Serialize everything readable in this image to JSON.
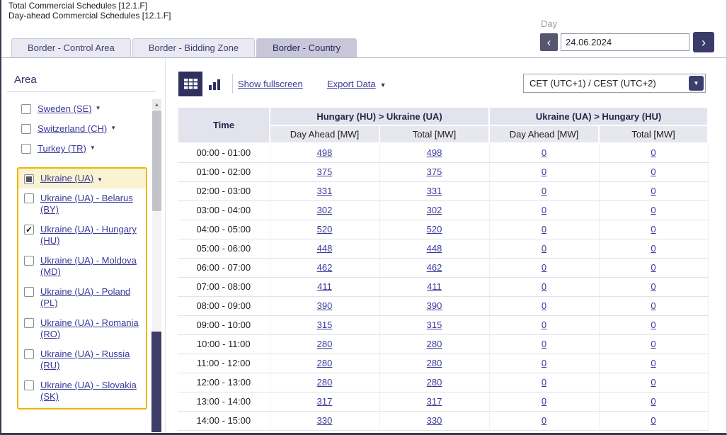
{
  "window": {
    "title_lines": [
      "Total Commercial Schedules [12.1.F]",
      "Day-ahead Commercial Schedules [12.1.F]"
    ]
  },
  "date_nav": {
    "label": "Day",
    "value": "24.06.2024"
  },
  "tabs": {
    "items": [
      {
        "label": "Border - Control Area",
        "active": false
      },
      {
        "label": "Border - Bidding Zone",
        "active": false
      },
      {
        "label": "Border - Country",
        "active": true
      }
    ]
  },
  "sidebar": {
    "heading": "Area",
    "items": [
      {
        "label": "Sweden (SE)",
        "state": "unchecked",
        "expander": true
      },
      {
        "label": "Switzerland (CH)",
        "state": "unchecked",
        "expander": true
      },
      {
        "label": "Turkey (TR)",
        "state": "unchecked",
        "expander": true
      },
      {
        "label": "Ukraine (UA)",
        "state": "indeterminate",
        "expander": true,
        "highlighted": true
      },
      {
        "label": "Ukraine (UA) - Belarus (BY)",
        "state": "unchecked"
      },
      {
        "label": "Ukraine (UA) - Hungary (HU)",
        "state": "checked"
      },
      {
        "label": "Ukraine (UA) - Moldova (MD)",
        "state": "unchecked"
      },
      {
        "label": "Ukraine (UA) - Poland (PL)",
        "state": "unchecked"
      },
      {
        "label": "Ukraine (UA) - Romania (RO)",
        "state": "unchecked"
      },
      {
        "label": "Ukraine (UA) - Russia (RU)",
        "state": "unchecked"
      },
      {
        "label": "Ukraine (UA) - Slovakia (SK)",
        "state": "unchecked"
      }
    ]
  },
  "toolbar": {
    "fullscreen_label": "Show fullscreen",
    "export_label": "Export Data",
    "timezone_value": "CET (UTC+1) / CEST (UTC+2)"
  },
  "table": {
    "time_header": "Time",
    "groups": [
      "Hungary (HU) > Ukraine (UA)",
      "Ukraine (UA) > Hungary (HU)"
    ],
    "subheaders": [
      "Day Ahead [MW]",
      "Total [MW]",
      "Day Ahead [MW]",
      "Total [MW]"
    ],
    "rows": [
      {
        "time": "00:00 - 01:00",
        "values": [
          "498",
          "498",
          "0",
          "0"
        ]
      },
      {
        "time": "01:00 - 02:00",
        "values": [
          "375",
          "375",
          "0",
          "0"
        ]
      },
      {
        "time": "02:00 - 03:00",
        "values": [
          "331",
          "331",
          "0",
          "0"
        ]
      },
      {
        "time": "03:00 - 04:00",
        "values": [
          "302",
          "302",
          "0",
          "0"
        ]
      },
      {
        "time": "04:00 - 05:00",
        "values": [
          "520",
          "520",
          "0",
          "0"
        ]
      },
      {
        "time": "05:00 - 06:00",
        "values": [
          "448",
          "448",
          "0",
          "0"
        ]
      },
      {
        "time": "06:00 - 07:00",
        "values": [
          "462",
          "462",
          "0",
          "0"
        ]
      },
      {
        "time": "07:00 - 08:00",
        "values": [
          "411",
          "411",
          "0",
          "0"
        ]
      },
      {
        "time": "08:00 - 09:00",
        "values": [
          "390",
          "390",
          "0",
          "0"
        ]
      },
      {
        "time": "09:00 - 10:00",
        "values": [
          "315",
          "315",
          "0",
          "0"
        ]
      },
      {
        "time": "10:00 - 11:00",
        "values": [
          "280",
          "280",
          "0",
          "0"
        ]
      },
      {
        "time": "11:00 - 12:00",
        "values": [
          "280",
          "280",
          "0",
          "0"
        ]
      },
      {
        "time": "12:00 - 13:00",
        "values": [
          "280",
          "280",
          "0",
          "0"
        ]
      },
      {
        "time": "13:00 - 14:00",
        "values": [
          "317",
          "317",
          "0",
          "0"
        ]
      },
      {
        "time": "14:00 - 15:00",
        "values": [
          "330",
          "330",
          "0",
          "0"
        ]
      }
    ]
  },
  "icons": {
    "chevron_down": "▼",
    "check": "✓",
    "prev": "‹",
    "next": "›",
    "scroll_up": "▲"
  },
  "colors": {
    "accent_navy": "#30305e",
    "link": "#3a3a9a",
    "highlight_border": "#efb400",
    "highlight_bg": "#faf3d2",
    "header_bg": "#e3e3ed",
    "tab_active_bg": "#c7c7d9"
  }
}
